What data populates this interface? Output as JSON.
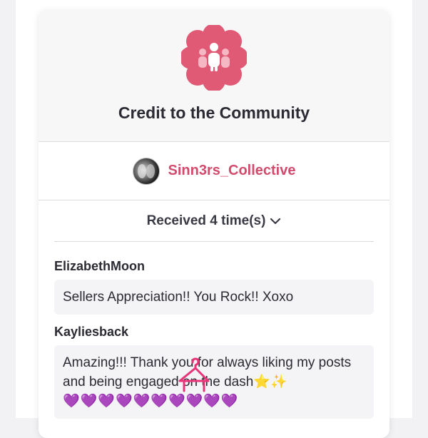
{
  "card": {
    "title": "Credit to the Community",
    "badge_icon": "community-badge-icon"
  },
  "creator": {
    "name": "Sinn3rs_Collective",
    "avatar": "avatar"
  },
  "received": {
    "label": "Received 4 time(s)",
    "toggle_icon": "chevron-down-icon"
  },
  "messages": [
    {
      "author": "ElizabethMoon",
      "text": "Sellers Appreciation!! You Rock!! Xoxo"
    },
    {
      "author": "Kayliesback",
      "text": "Amazing!!! Thank you for always liking my posts and being engaged on the dash",
      "stars": "⭐✨",
      "hearts": "💜💜💜💜💜💜💜💜💜💜"
    }
  ],
  "colors": {
    "brand_pink": "#d24a6c",
    "badge_pink": "#e05a76",
    "heart_purple": "#8b3fe0"
  }
}
